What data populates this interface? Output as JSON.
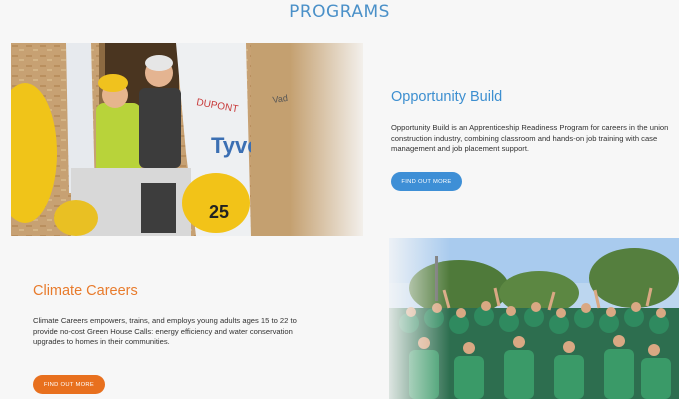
{
  "programs": {
    "heading": "PROGRAMS"
  },
  "opportunity_build": {
    "title": "Opportunity Build",
    "description": "Opportunity Build is an Apprenticeship Readiness Program for careers in the union construction industry, combining classroom and hands-on job training with case management and job placement support.",
    "button_label": "FIND OUT MORE",
    "photo_text": {
      "wrap_brand": "DUPONT",
      "wrap_sub": "Tyvek",
      "hardhat_number": "25"
    }
  },
  "climate_careers": {
    "title": "Climate Careers",
    "description": "Climate Careers empowers, trains, and employs young adults ages 15 to 22 to provide no-cost Green House Calls: energy efficiency and water conservation upgrades to homes in their communities.",
    "button_label": "FIND OUT MORE"
  },
  "colors": {
    "blue_accent": "#3e8fd6",
    "orange_accent": "#e8701e",
    "background": "#f7f7f7"
  }
}
